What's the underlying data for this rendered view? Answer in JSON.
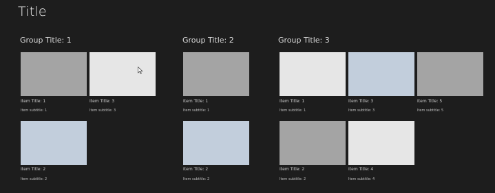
{
  "page": {
    "title": "Title"
  },
  "groups": [
    {
      "title": "Group Title: 1",
      "items": [
        {
          "title": "Item Title: 1",
          "subtitle": "Item subtitle: 1",
          "color": "#a4a4a4"
        },
        {
          "title": "Item Title: 3",
          "subtitle": "Item subtitle: 3",
          "color": "#e6e6e6"
        },
        {
          "title": "Item Title: 2",
          "subtitle": "Item subtitle: 2",
          "color": "#c2cedc"
        }
      ]
    },
    {
      "title": "Group Title: 2",
      "items": [
        {
          "title": "Item Title: 1",
          "subtitle": "Item subtitle: 1",
          "color": "#a4a4a4"
        },
        {
          "title": "Item Title: 2",
          "subtitle": "Item subtitle: 2",
          "color": "#c2cedc"
        }
      ]
    },
    {
      "title": "Group Title: 3",
      "items": [
        {
          "title": "Item Title: 1",
          "subtitle": "Item subtitle: 1",
          "color": "#e6e6e6"
        },
        {
          "title": "Item Title: 3",
          "subtitle": "Item subtitle: 3",
          "color": "#c2cedc"
        },
        {
          "title": "Item Title: 5",
          "subtitle": "Item subtitle: 5",
          "color": "#a4a4a4"
        },
        {
          "title": "Item Title: 2",
          "subtitle": "Item subtitle: 2",
          "color": "#a4a4a4"
        },
        {
          "title": "Item Title: 4",
          "subtitle": "Item subtitle: 4",
          "color": "#e6e6e6"
        }
      ]
    }
  ]
}
